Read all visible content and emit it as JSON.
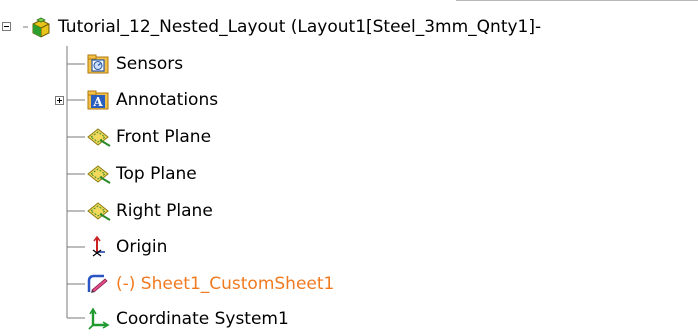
{
  "root": {
    "label": "Tutorial_12_Nested_Layout  (Layout1[Steel_3mm_Qnty1]-",
    "expanded": true,
    "icon": "part-icon"
  },
  "items": [
    {
      "label": "Sensors",
      "icon": "sensors-folder-icon",
      "expandable": false
    },
    {
      "label": "Annotations",
      "icon": "annotations-icon",
      "expandable": true,
      "expanded": false
    },
    {
      "label": "Front Plane",
      "icon": "plane-icon",
      "expandable": false
    },
    {
      "label": "Top Plane",
      "icon": "plane-icon",
      "expandable": false
    },
    {
      "label": "Right Plane",
      "icon": "plane-icon",
      "expandable": false
    },
    {
      "label": "Origin",
      "icon": "origin-icon",
      "expandable": false
    },
    {
      "label": "(-) Sheet1_CustomSheet1",
      "icon": "sketch-icon",
      "expandable": false,
      "color": "#f07a20"
    },
    {
      "label": "Coordinate System1",
      "icon": "coordinate-system-icon",
      "expandable": false
    }
  ],
  "colors": {
    "tree_line": "#7a7a7a",
    "sketch_label": "#f07a20",
    "top_border": "#b8b8b8"
  }
}
